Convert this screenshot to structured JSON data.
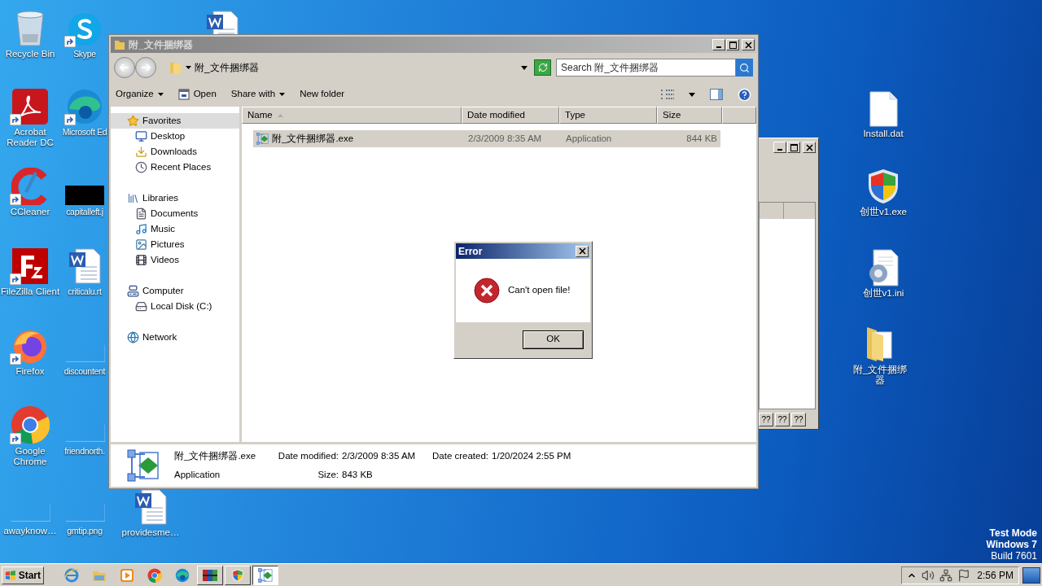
{
  "desktop": {
    "icons": [
      {
        "label": "Recycle Bin",
        "kind": "recycle",
        "shortcut": false
      },
      {
        "label": "Skype",
        "kind": "skype",
        "shortcut": true
      },
      {
        "kind": "word",
        "shortcut": false
      },
      {
        "label": "Acrobat Reader DC",
        "kind": "acrobat",
        "shortcut": true
      },
      {
        "label": "Microsoft Ed",
        "kind": "edge",
        "shortcut": true
      },
      {
        "label": "CCleaner",
        "kind": "ccleaner",
        "shortcut": true
      },
      {
        "label": "capitalleft.j",
        "kind": "dark-image",
        "shortcut": false
      },
      {
        "label": "FileZilla Client",
        "kind": "filezilla",
        "shortcut": true
      },
      {
        "label": "criticalu.rt",
        "kind": "word",
        "shortcut": false
      },
      {
        "label": "Firefox",
        "kind": "firefox",
        "shortcut": true
      },
      {
        "label": "discountent",
        "kind": "blank",
        "shortcut": false
      },
      {
        "label": "Google Chrome",
        "kind": "chrome",
        "shortcut": true
      },
      {
        "label": "friendnorth.",
        "kind": "blank",
        "shortcut": false
      },
      {
        "label": "awayknow…",
        "kind": "blank",
        "shortcut": false
      },
      {
        "label": "gmtip.png",
        "kind": "blank",
        "shortcut": false
      },
      {
        "label": "providesme…",
        "kind": "word",
        "shortcut": false
      },
      {
        "label": "Install.dat",
        "kind": "file",
        "shortcut": false
      },
      {
        "label": "创世v1.exe",
        "kind": "shield",
        "shortcut": false
      },
      {
        "label": "创世v1.ini",
        "kind": "ini",
        "shortcut": false
      },
      {
        "label": "附_文件捆绑器",
        "kind": "folder",
        "shortcut": false
      }
    ],
    "os_notice": [
      "Test Mode",
      "Windows 7",
      "Build 7601"
    ]
  },
  "background_window": {
    "buttons": [
      "??",
      "??",
      "??"
    ]
  },
  "explorer": {
    "title": "附_文件捆绑器",
    "address": "附_文件捆绑器",
    "search": {
      "placeholder": "Search 附_文件捆绑器"
    },
    "toolbar": [
      {
        "label": "Organize",
        "kind": "menu"
      },
      {
        "label": "Open",
        "kind": "open"
      },
      {
        "label": "Share with",
        "kind": "menu"
      },
      {
        "label": "New folder",
        "kind": "plain"
      }
    ],
    "nav": [
      {
        "label": "Favorites",
        "kind": "star",
        "selected": true,
        "children": [
          {
            "label": "Desktop",
            "kind": "desktop",
            "selected": false
          },
          {
            "label": "Downloads",
            "kind": "downloads",
            "selected": false
          },
          {
            "label": "Recent Places",
            "kind": "recent",
            "selected": false
          }
        ]
      },
      {
        "label": "Libraries",
        "kind": "libraries",
        "selected": false,
        "children": [
          {
            "label": "Documents",
            "kind": "documents",
            "selected": false
          },
          {
            "label": "Music",
            "kind": "music",
            "selected": false
          },
          {
            "label": "Pictures",
            "kind": "pictures",
            "selected": false
          },
          {
            "label": "Videos",
            "kind": "videos",
            "selected": false
          }
        ]
      },
      {
        "label": "Computer",
        "kind": "computer",
        "selected": false,
        "children": [
          {
            "label": "Local Disk (C:)",
            "kind": "disk",
            "selected": false
          }
        ]
      },
      {
        "label": "Network",
        "kind": "network",
        "selected": false
      }
    ],
    "columns": [
      "Name",
      "Date modified",
      "Type",
      "Size"
    ],
    "rows": [
      {
        "name": "附_文件捆绑器.exe",
        "date": "2/3/2009 8:35 AM",
        "type": "Application",
        "size": "844 KB",
        "selected": true
      }
    ],
    "details": {
      "name": "附_文件捆绑器.exe",
      "modified_label": "Date modified:",
      "modified": "2/3/2009 8:35 AM",
      "created_label": "Date created:",
      "created": "1/20/2024 2:55 PM",
      "type": "Application",
      "size_label": "Size:",
      "size": "843 KB"
    }
  },
  "dialog": {
    "title": "Error",
    "message": "Can't open file!",
    "button": "OK"
  },
  "taskbar": {
    "start": "Start",
    "items": [
      {
        "kind": "ie",
        "selected": false
      },
      {
        "kind": "explorer",
        "selected": false
      },
      {
        "kind": "media",
        "selected": false
      },
      {
        "kind": "chrome",
        "selected": false
      },
      {
        "kind": "edge",
        "selected": false
      },
      {
        "kind": "winrar",
        "selected": false
      },
      {
        "kind": "shield",
        "selected": false
      },
      {
        "kind": "app",
        "selected": true
      }
    ],
    "time": "2:56 PM"
  }
}
